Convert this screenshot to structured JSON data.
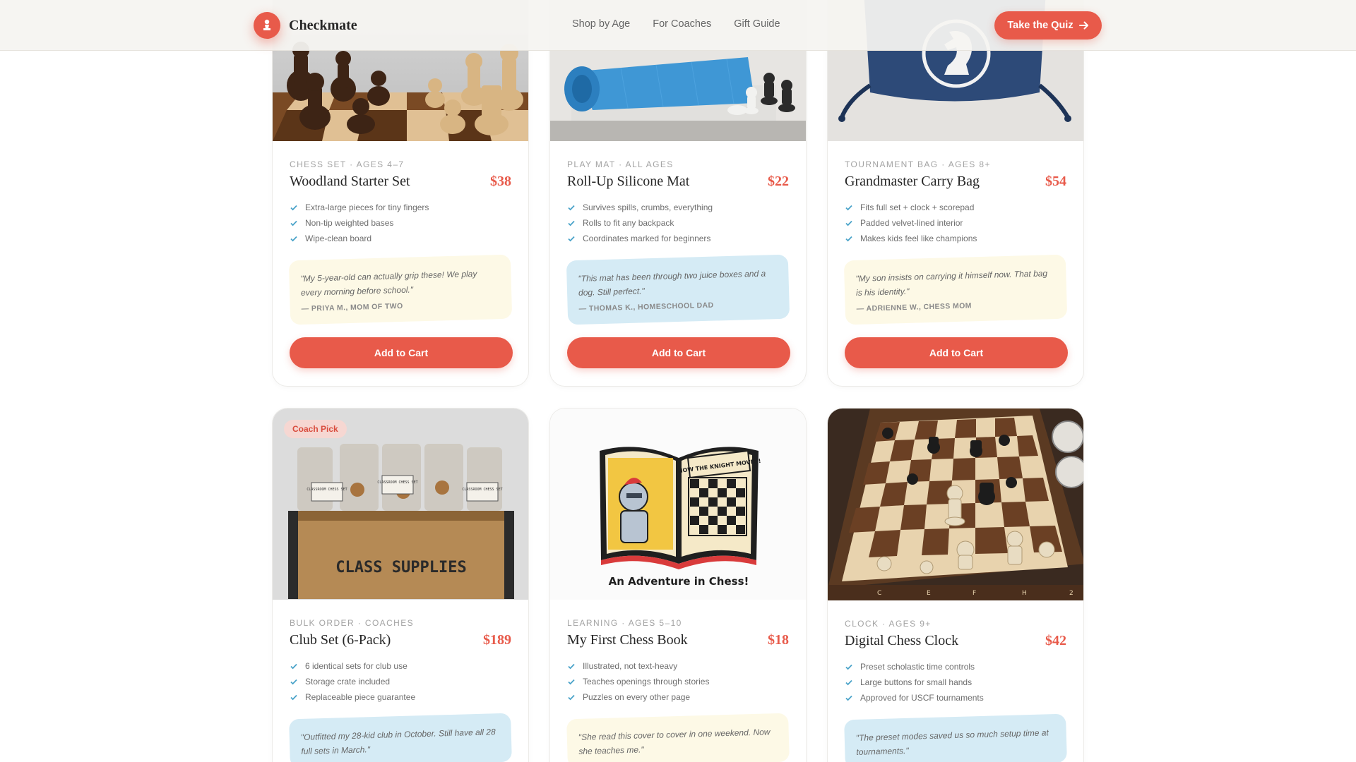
{
  "brand": {
    "name": "Checkmate",
    "accent": "#e85a4a",
    "icon": "chess-pawn-icon"
  },
  "nav": {
    "items": [
      "Shop by Age",
      "For Coaches",
      "Gift Guide"
    ]
  },
  "header": {
    "quiz_label": "Take the Quiz",
    "quiz_icon": "arrow-right-icon"
  },
  "cart_label": "Add to Cart",
  "products": [
    {
      "category": "CHESS SET · AGES 4–7",
      "name": "Woodland Starter Set",
      "price": "$38",
      "features": [
        "Extra-large pieces for tiny fingers",
        "Non-tip weighted bases",
        "Wipe-clean board"
      ],
      "quote": "\"My 5-year-old can actually grip these! We play every morning before school.\"",
      "author": "— PRIYA M., MOM OF TWO",
      "quote_color": "yellow"
    },
    {
      "category": "PLAY MAT · ALL AGES",
      "name": "Roll-Up Silicone Mat",
      "price": "$22",
      "features": [
        "Survives spills, crumbs, everything",
        "Rolls to fit any backpack",
        "Coordinates marked for beginners"
      ],
      "quote": "\"This mat has been through two juice boxes and a dog. Still perfect.\"",
      "author": "— THOMAS K., HOMESCHOOL DAD",
      "quote_color": "blue"
    },
    {
      "category": "TOURNAMENT BAG · AGES 8+",
      "name": "Grandmaster Carry Bag",
      "price": "$54",
      "features": [
        "Fits full set + clock + scorepad",
        "Padded velvet-lined interior",
        "Makes kids feel like champions"
      ],
      "quote": "\"My son insists on carrying it himself now. That bag is his identity.\"",
      "author": "— ADRIENNE W., CHESS MOM",
      "quote_color": "yellow"
    },
    {
      "badge": "Coach Pick",
      "category": "BULK ORDER · COACHES",
      "name": "Club Set (6-Pack)",
      "price": "$189",
      "features": [
        "6 identical sets for club use",
        "Storage crate included",
        "Replaceable piece guarantee"
      ],
      "quote": "\"Outfitted my 28-kid club in October. Still have all 28 full sets in March.\"",
      "quote_color": "blue",
      "image_text": {
        "crate": "CLASS SUPPLIES",
        "tag": "CLASSROOM CHESS SET"
      }
    },
    {
      "category": "LEARNING · AGES 5–10",
      "name": "My First Chess Book",
      "price": "$18",
      "features": [
        "Illustrated, not text-heavy",
        "Teaches openings through stories",
        "Puzzles on every other page"
      ],
      "quote": "\"She read this cover to cover in one weekend. Now she teaches me.\"",
      "quote_color": "yellow",
      "image_text": {
        "book_banner": "HOW THE KNIGHT MOVES!",
        "book_title": "An Adventure in Chess!"
      }
    },
    {
      "category": "CLOCK · AGES 9+",
      "name": "Digital Chess Clock",
      "price": "$42",
      "features": [
        "Preset scholastic time controls",
        "Large buttons for small hands",
        "Approved for USCF tournaments"
      ],
      "quote": "\"The preset modes saved us so much setup time at tournaments.\"",
      "quote_color": "blue",
      "image_text": {
        "files": [
          "C",
          "E",
          "F",
          "H",
          "2"
        ]
      }
    }
  ]
}
